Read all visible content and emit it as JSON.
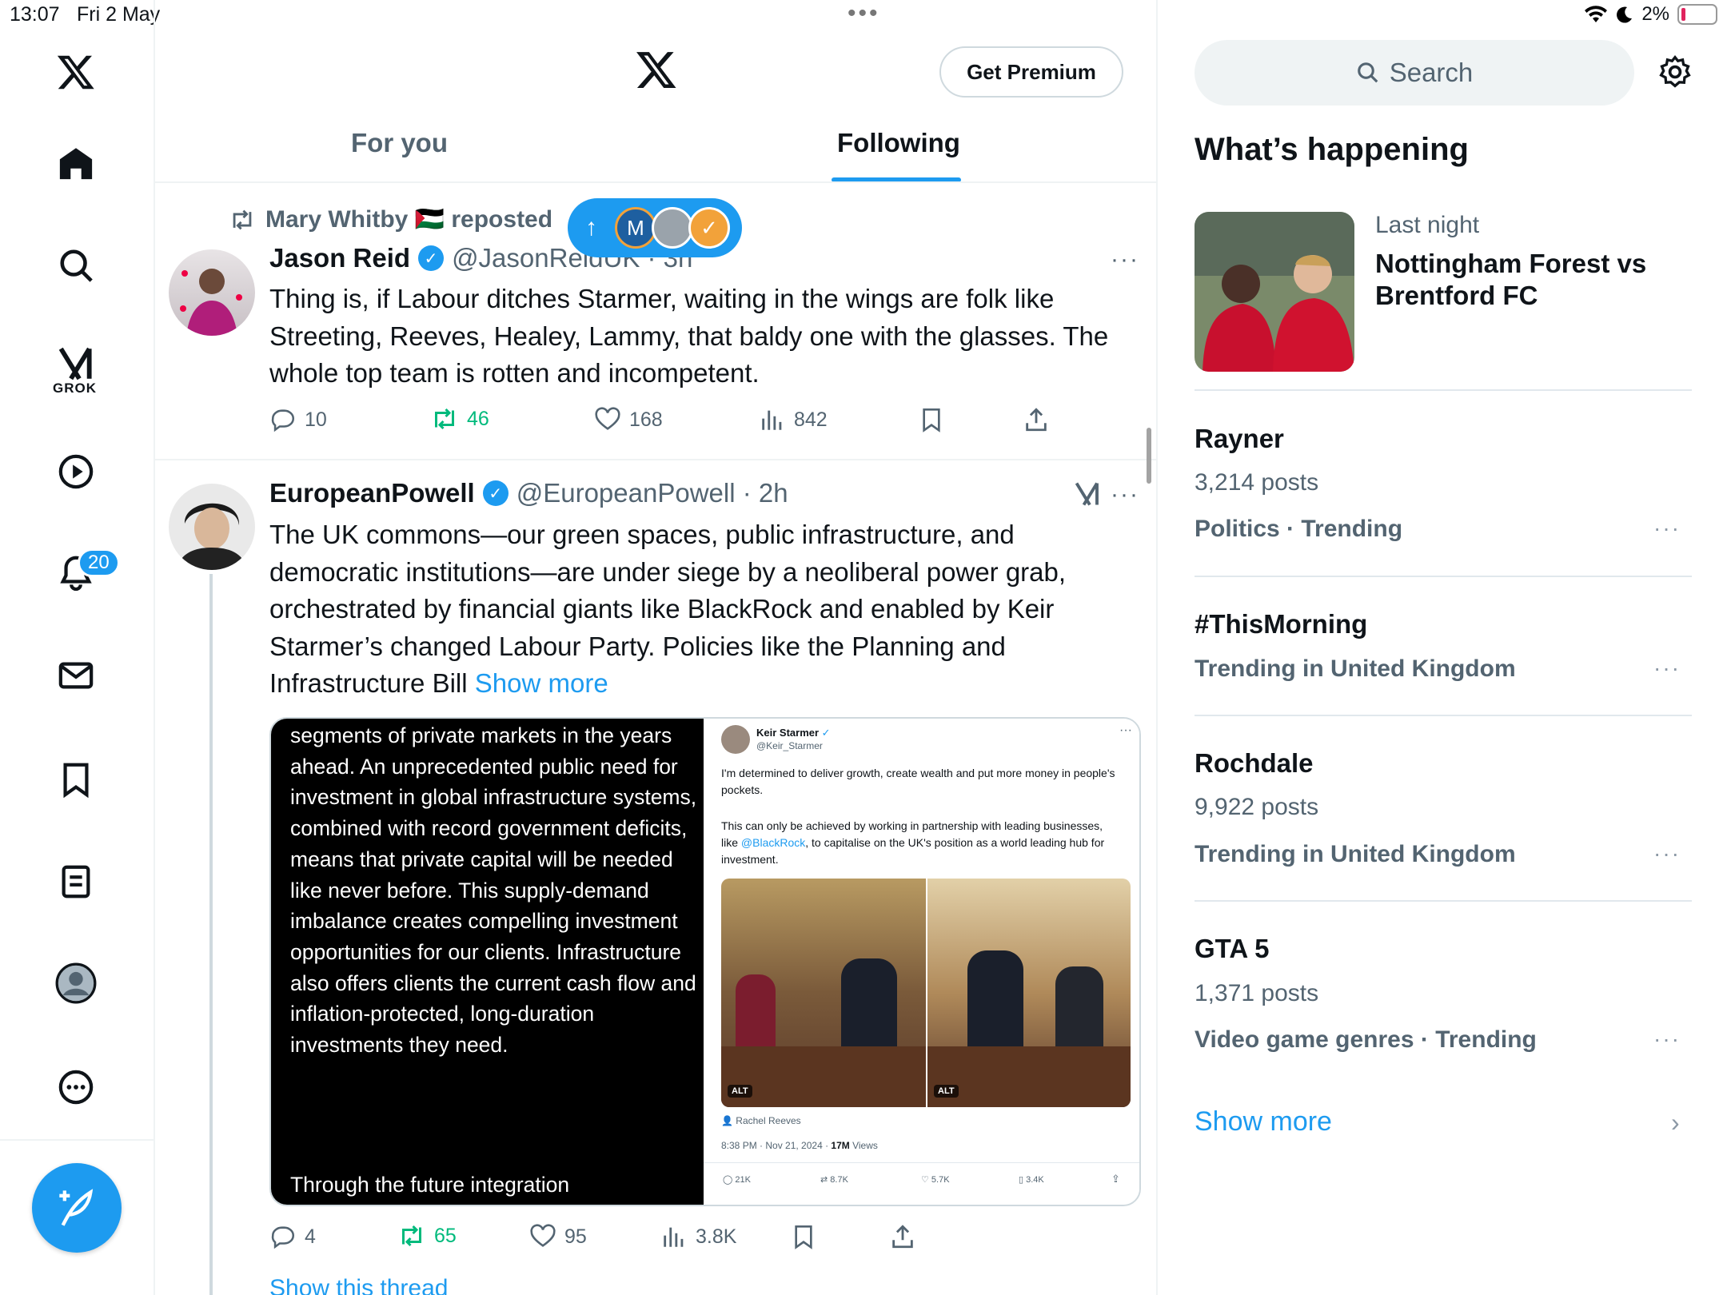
{
  "status": {
    "time": "13:07",
    "date": "Fri 2 May",
    "battery": "2%"
  },
  "nav": {
    "grok_label": "GROK",
    "notifications_badge": "20"
  },
  "header": {
    "premium_label": "Get Premium"
  },
  "tabs": [
    {
      "label": "For you"
    },
    {
      "label": "Following"
    }
  ],
  "new_posts_pill": {
    "avatar_letter": "M"
  },
  "tweet1": {
    "repost_by": "Mary Whitby 🇵🇸 reposted",
    "name": "Jason Reid",
    "handle": "@JasonReidUK · 3h",
    "text": "Thing is, if Labour ditches Starmer, waiting in the wings are folk like Streeting, Reeves, Healey, Lammy, that baldy one with the glasses. The whole top team is rotten and incompetent.",
    "replies": "10",
    "reposts": "46",
    "likes": "168",
    "views": "842"
  },
  "tweet2": {
    "name": "EuropeanPowell",
    "handle": "@EuropeanPowell · 2h",
    "text": "The UK commons—our green spaces, public infrastructure, and democratic institutions—are under siege by a neoliberal power grab, orchestrated by financial giants like BlackRock and enabled by Keir Starmer’s changed Labour Party. Policies like the Planning and Infrastructure Bill",
    "show_more": "Show more",
    "replies": "4",
    "reposts": "65",
    "likes": "95",
    "views": "3.8K",
    "show_thread": "Show this thread",
    "image_left_text": "segments of private markets in the years ahead. An unprecedented public need for investment in global infrastructure systems, combined with record government deficits, means that private capital will be needed like never before. This supply-demand imbalance creates compelling investment opportunities for our clients. Infrastructure also offers clients the current cash flow and inflation-protected, long-duration investments they need.",
    "image_left_text2": "Through the future integration",
    "embedded": {
      "name": "Keir Starmer",
      "handle": "@Keir_Starmer",
      "para1": "I'm determined to deliver growth, create wealth and put more money in people's pockets.",
      "para2_a": "This can only be achieved by working in partnership with leading businesses, like ",
      "para2_link": "@BlackRock",
      "para2_b": ", to capitalise on the UK's position as a world leading hub for investment.",
      "tagged": "Rachel Reeves",
      "timestamp": "8:38 PM · Nov 21, 2024 · ",
      "views": "17M",
      "views_label": " Views",
      "alt": "ALT",
      "replies": "21K",
      "reposts": "8.7K",
      "likes": "5.7K",
      "bookmarks": "3.4K"
    }
  },
  "sidebar": {
    "search_placeholder": "Search",
    "heading": "What’s happening",
    "featured": {
      "meta": "Last night",
      "title": "Nottingham Forest vs Brentford FC"
    },
    "trends": [
      {
        "title": "Rayner",
        "posts": "3,214 posts",
        "category": "Politics · Trending"
      },
      {
        "title": "#ThisMorning",
        "posts": "",
        "category": "Trending in United Kingdom"
      },
      {
        "title": "Rochdale",
        "posts": "9,922 posts",
        "category": "Trending in United Kingdom"
      },
      {
        "title": "GTA 5",
        "posts": "1,371 posts",
        "category": "Video game genres · Trending"
      }
    ],
    "show_more": "Show more"
  },
  "colors": {
    "accent": "#1d9bf0",
    "repost_green": "#00ba7c",
    "text_secondary": "#536471"
  }
}
